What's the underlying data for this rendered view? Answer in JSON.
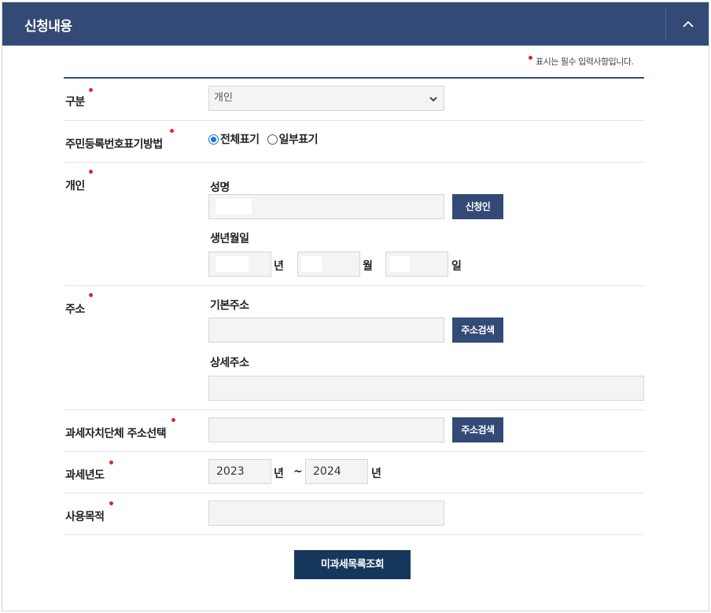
{
  "header": {
    "title": "신청내용",
    "toggle_icon": "chevron-up-icon"
  },
  "required_note": "표시는 필수 입력사항입니다.",
  "colors": {
    "header_bg": "#334a76",
    "required_dot": "#e0242b",
    "button_navy": "#334a76",
    "submit_bg": "#16375c"
  },
  "fields": {
    "category": {
      "label": "구분",
      "value": "개인"
    },
    "rrn_display": {
      "label": "주민등록번호표기방법",
      "options": [
        "전체표기",
        "일부표기"
      ],
      "selected": "전체표기"
    },
    "individual": {
      "label": "개인",
      "name_label": "성명",
      "name_value": "",
      "applicant_button": "신청인",
      "birth_label": "생년월일",
      "year_unit": "년",
      "month_unit": "월",
      "day_unit": "일"
    },
    "address": {
      "label": "주소",
      "basic_label": "기본주소",
      "basic_value": "",
      "search_button": "주소검색",
      "detail_label": "상세주소",
      "detail_value": ""
    },
    "tax_authority": {
      "label": "과세자치단체 주소선택",
      "value": "",
      "search_button": "주소검색"
    },
    "tax_year": {
      "label": "과세년도",
      "from": "2023",
      "to": "2024",
      "unit": "년",
      "separator": "~"
    },
    "purpose": {
      "label": "사용목적",
      "value": ""
    }
  },
  "submit_button": "미과세목록조회"
}
